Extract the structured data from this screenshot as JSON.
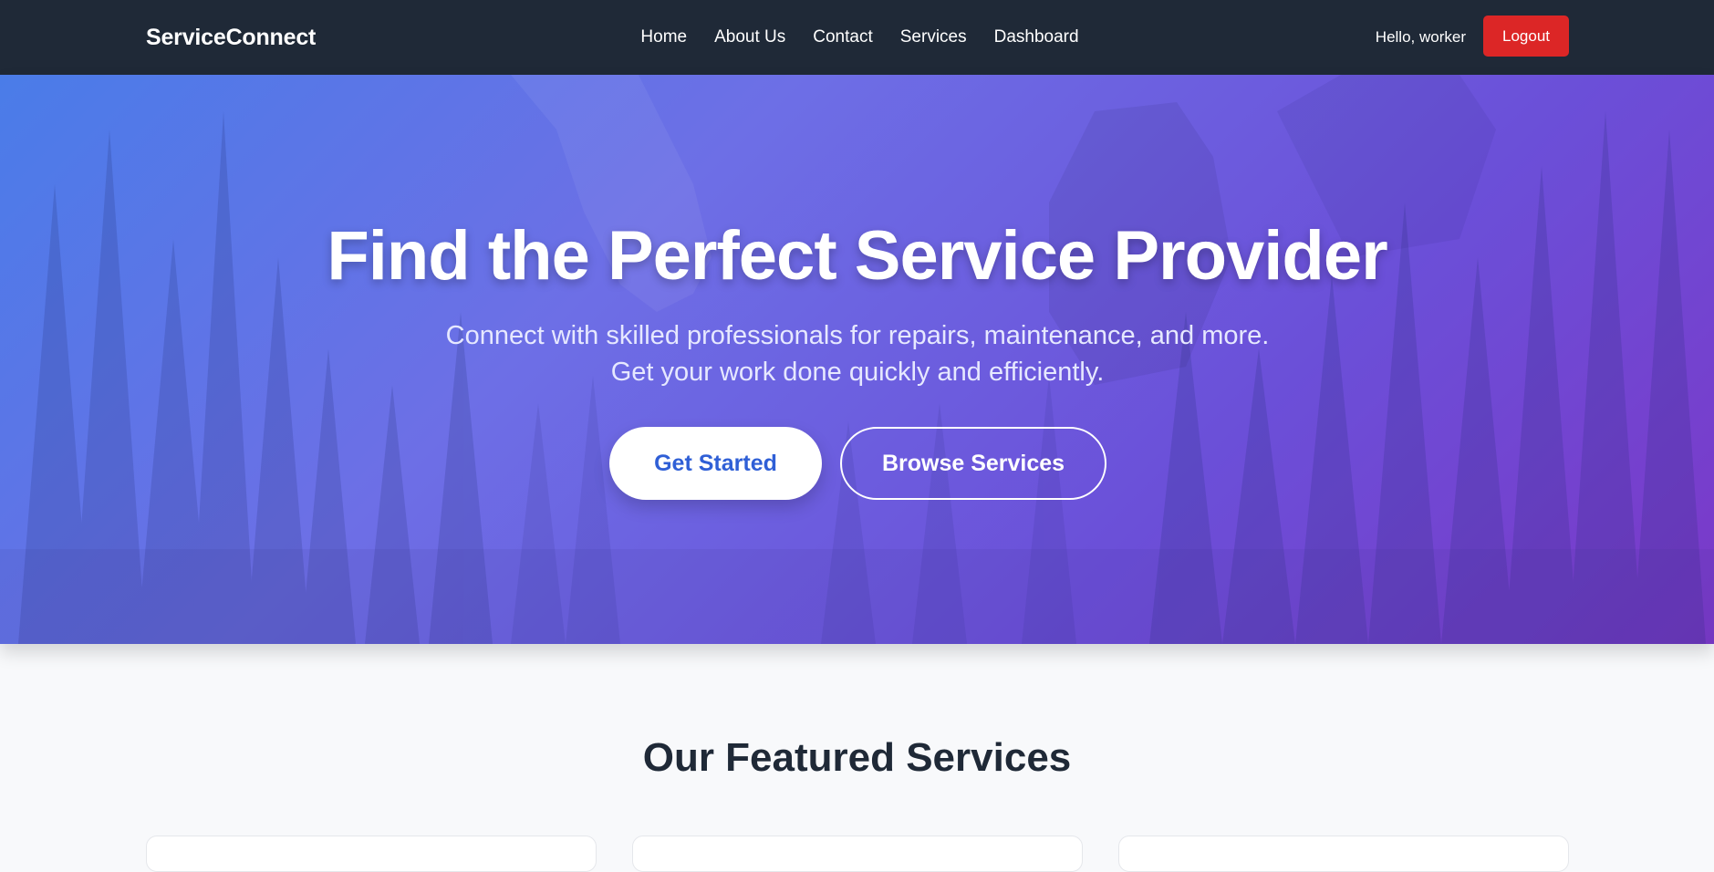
{
  "navbar": {
    "brand": "ServiceConnect",
    "links": [
      "Home",
      "About Us",
      "Contact",
      "Services",
      "Dashboard"
    ],
    "greeting": "Hello, worker",
    "logout_label": "Logout",
    "logout_color": "#dc2626",
    "background": "#1f2937"
  },
  "hero": {
    "title": "Find the Perfect Service Provider",
    "subtitle": "Connect with skilled professionals for repairs, maintenance, and more. Get your work done quickly and efficiently.",
    "primary_cta": "Get Started",
    "secondary_cta": "Browse Services",
    "gradient_colors": [
      "#4a7ce8",
      "#6d6fe6",
      "#7b38c8"
    ]
  },
  "featured": {
    "title": "Our Featured Services"
  }
}
